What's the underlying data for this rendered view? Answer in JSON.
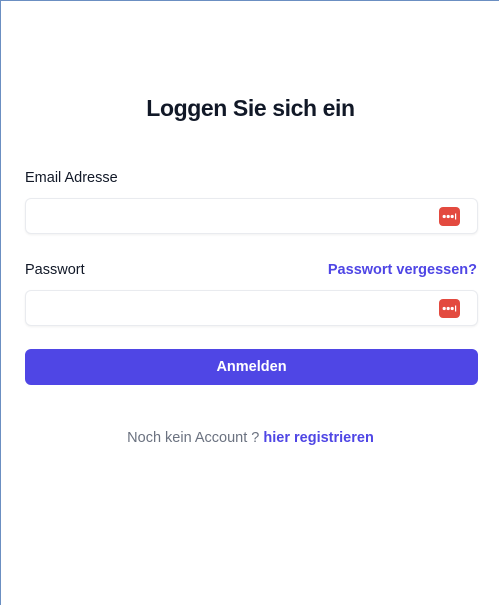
{
  "form": {
    "title": "Loggen Sie sich ein",
    "email": {
      "label": "Email Adresse",
      "value": "",
      "placeholder": ""
    },
    "password": {
      "label": "Passwort",
      "value": "",
      "placeholder": "",
      "forgot_link": "Passwort vergessen?"
    },
    "submit_label": "Anmelden",
    "register": {
      "prompt": "Noch kein Account ?",
      "link": "hier registrieren"
    }
  },
  "icons": {
    "password_manager": "password-manager-icon"
  },
  "colors": {
    "accent": "#4f46e5",
    "text": "#111827",
    "muted": "#6b7280",
    "password_manager_icon": "#e34a3f"
  }
}
